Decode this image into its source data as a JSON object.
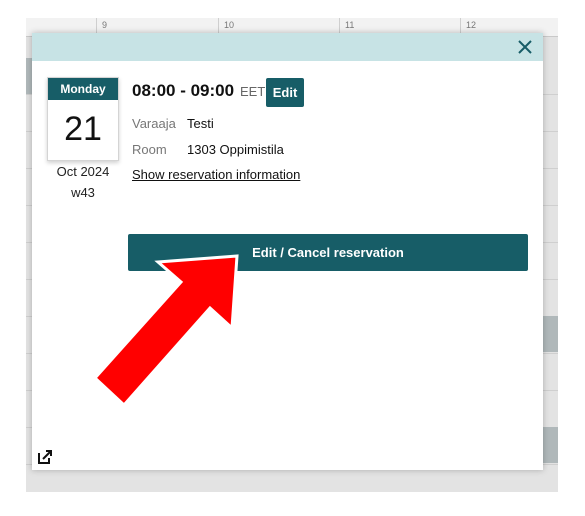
{
  "calendar_bg": {
    "hours": [
      "9",
      "10",
      "11",
      "12"
    ]
  },
  "event": {
    "weekday": "Monday",
    "day": "21",
    "month_year": "Oct 2024",
    "week": "w43",
    "time_range": "08:00 - 09:00",
    "timezone": "EET",
    "edit_label": "Edit",
    "booker_label": "Varaaja",
    "booker_value": "Testi",
    "room_label": "Room",
    "room_value": "1303 Oppimistila",
    "show_info_label": "Show reservation information",
    "edit_cancel_label": "Edit / Cancel reservation"
  },
  "icons": {
    "close": "close-icon",
    "external_link": "external-link-icon"
  },
  "colors": {
    "accent": "#175d67",
    "header_bg": "#c7e3e5",
    "annotation_arrow": "#ff0000"
  }
}
